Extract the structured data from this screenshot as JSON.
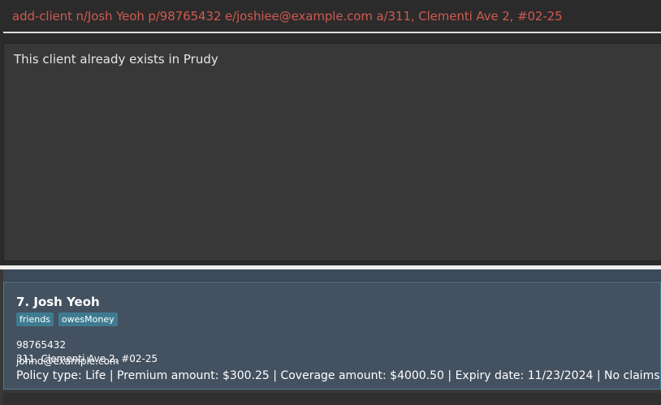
{
  "command_box": {
    "input_value": "add-client n/Josh Yeoh p/98765432 e/joshiee@example.com a/311, Clementi Ave 2, #02-25"
  },
  "result_display": {
    "message": "This client already exists in Prudy"
  },
  "client_list": {
    "clients": [
      {
        "index_name": "7. Josh Yeoh",
        "tags": [
          "friends",
          "owesMoney"
        ],
        "phone": "98765432",
        "address": "311, Clementi Ave 2, #02-25",
        "email": "johnd@example.com",
        "policy": "Policy type: Life | Premium amount: $300.25 | Coverage amount: $4000.50 | Expiry date: 11/23/2024 | No claims"
      }
    ]
  },
  "colors": {
    "background": "#2b2b2b",
    "command_text": "#cf5a50",
    "result_background": "#383838",
    "card_background": "#445160",
    "card_border": "#4a7d94",
    "tag_background": "#3e7b91",
    "divider": "#ededed"
  }
}
